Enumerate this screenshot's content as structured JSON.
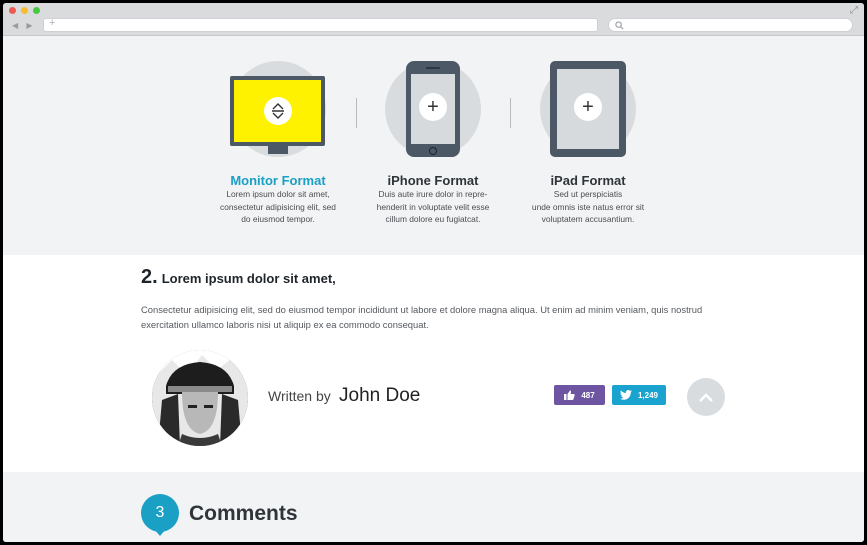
{
  "browser": {
    "nav_arrows": "◀ ▶",
    "url_plus": "+",
    "expand_icon": "⤢"
  },
  "formats": [
    {
      "title": "Monitor Format",
      "lines": [
        "Lorem ipsum dolor sit amet,",
        "consectetur adipisicing elit, sed",
        "do eiusmod tempor."
      ],
      "icon": "monitor-icon",
      "active": true
    },
    {
      "title": "iPhone Format",
      "lines": [
        "Duis aute irure dolor in repre-",
        "henderit in voluptate velit esse",
        "cillum dolore eu fugiatcat."
      ],
      "icon": "phone-icon",
      "active": false
    },
    {
      "title": "iPad Format",
      "lines": [
        "Sed ut perspiciatis",
        "unde omnis iste natus error sit",
        "voluptatem accusantium."
      ],
      "icon": "tablet-icon",
      "active": false
    }
  ],
  "article": {
    "number": "2.",
    "title": "Lorem ipsum dolor sit amet,",
    "body": "Consectetur adipisicing elit, sed do eiusmod tempor incididunt ut labore et dolore magna aliqua. Ut enim ad minim veniam, quis nostrud exercitation ullamco laboris nisi ut aliquip ex ea commodo consequat.",
    "written_by": "Written by",
    "author": "John Doe",
    "likes": "487",
    "tweets": "1,249"
  },
  "comments": {
    "count": "3",
    "title": "Comments"
  },
  "colors": {
    "accent": "#1aa0c5",
    "monitor_screen": "#fff200",
    "like_button": "#6d55a1",
    "tweet_button": "#1ba3d0"
  }
}
